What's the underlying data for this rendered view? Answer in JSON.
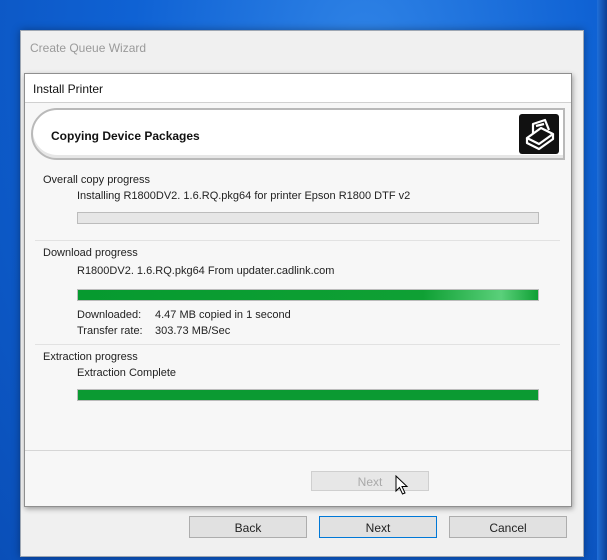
{
  "outer": {
    "title": "Create Queue Wizard",
    "buttons": {
      "back": "Back",
      "next": "Next",
      "cancel": "Cancel"
    }
  },
  "dialog": {
    "title": "Install Printer",
    "header": "Copying Device Packages",
    "header_icon": "printer-icon",
    "overall": {
      "title": "Overall copy progress",
      "status": "Installing R1800DV2. 1.6.RQ.pkg64 for printer Epson R1800 DTF v2",
      "progress_percent": 0
    },
    "download": {
      "title": "Download progress",
      "status": "R1800DV2. 1.6.RQ.pkg64 From updater.cadlink.com",
      "progress_percent": 100,
      "downloaded_label": "Downloaded:",
      "downloaded_value": "4.47 MB copied in 1 second",
      "rate_label": "Transfer rate:",
      "rate_value": "303.73 MB/Sec"
    },
    "extraction": {
      "title": "Extraction progress",
      "status": "Extraction Complete",
      "progress_percent": 100
    },
    "next_label": "Next"
  },
  "colors": {
    "progress": "#0b9a32",
    "desktop": "#0f62d4"
  }
}
